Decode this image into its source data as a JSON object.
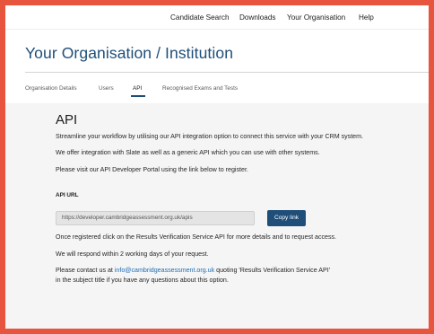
{
  "nav": {
    "items": [
      "Candidate Search",
      "Downloads",
      "Your Organisation",
      "Help"
    ]
  },
  "header": {
    "title": "Your Organisation / Institution"
  },
  "tabs": [
    {
      "label": "Organisation Details",
      "active": false
    },
    {
      "label": "Users",
      "active": false
    },
    {
      "label": "API",
      "active": true
    },
    {
      "label": "Recognised Exams and Tests",
      "active": false
    }
  ],
  "main": {
    "heading": "API",
    "intro_1": "Streamline your workflow by utilising our API integration option to connect this service with your CRM system.",
    "intro_2": "We offer integration with Slate as well as a generic API which you can use with other systems.",
    "intro_3": "Please visit our API Developer Portal using the link below to register.",
    "url_label": "API URL",
    "url_value": "https://developer.cambridgeassessment.org.uk/apis",
    "copy_button": "Copy link",
    "after_1": "Once registered click on the Results Verification Service API for more details and to request access.",
    "after_2": "We will respond within 2 working days of your request.",
    "contact_prefix": "Please contact us at ",
    "contact_email": "info@cambridgeassessment.org.uk",
    "contact_suffix": " quoting 'Results Verification Service API'",
    "contact_line2": "in the subject title if you have any questions about this option."
  },
  "colors": {
    "frame_border": "#e8553f",
    "brand_blue": "#1f4e79",
    "link_blue": "#1f6fb5",
    "panel_bg": "#f5f5f5"
  }
}
